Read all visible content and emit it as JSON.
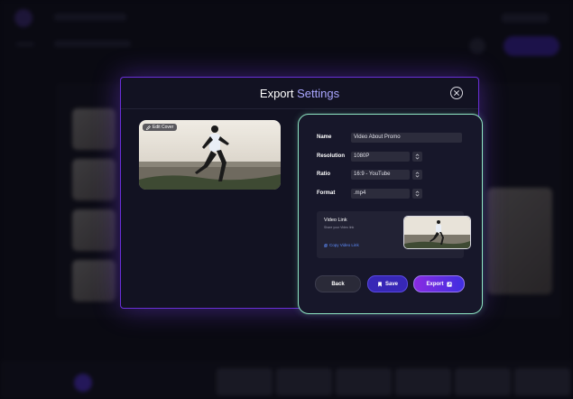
{
  "modal": {
    "title_part1": "Export",
    "title_part2": "Settings"
  },
  "cover": {
    "edit_label": "Edit Cover"
  },
  "form": {
    "name_label": "Name",
    "name_value": "Video About Promo",
    "resolution_label": "Resolution",
    "resolution_value": "1080P",
    "ratio_label": "Ratio",
    "ratio_value": "16:9 - YouTube",
    "format_label": "Format",
    "format_value": ".mp4"
  },
  "video_link": {
    "title": "Video Link",
    "subtitle": "Share your Video link",
    "copy_label": "Copy Video Link"
  },
  "buttons": {
    "back": "Back",
    "save": "Save",
    "export": "Export"
  },
  "colors": {
    "accent": "#6a2fd8",
    "panel_border": "#8fe7c4",
    "title_highlight": "#a9a6ff",
    "save": "#3727b6",
    "link": "#5d8dff"
  },
  "icons": [
    "close-icon",
    "pencil-icon",
    "chevron-updown-icon",
    "copy-icon",
    "bookmark-icon",
    "export-icon"
  ]
}
